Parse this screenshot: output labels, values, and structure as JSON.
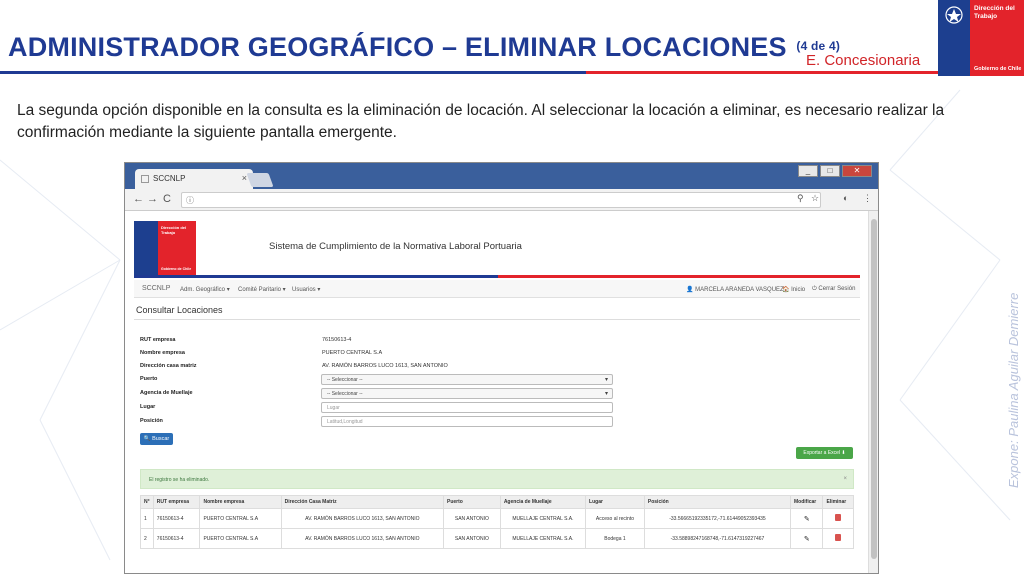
{
  "slide": {
    "title": "ADMINISTRADOR GEOGRÁFICO – ELIMINAR LOCACIONES",
    "title_sub": "(4 de 4)",
    "section": "E. Concesionaria",
    "intro": "La segunda opción disponible en la consulta es la eliminación de locación. Al seleccionar la locación a eliminar, es necesario realizar la confirmación mediante la siguiente pantalla emergente.",
    "credit": "Expone: Paulina Aguilar Demierre",
    "logo": {
      "line1": "Dirección del",
      "line2": "Trabajo",
      "footer": "Gobierno de Chile"
    },
    "colors": {
      "blue": "#1f3a93",
      "red": "#e3232b"
    }
  },
  "browser": {
    "tab_title": "SCCNLP",
    "tab_close": "×",
    "nav_back": "←",
    "nav_forward": "→",
    "nav_reload": "C",
    "url_info": "ⓘ",
    "win_min": "_",
    "win_max": "□",
    "win_close": "✕"
  },
  "app": {
    "logo": {
      "line1": "Dirección del",
      "line2": "Trabajo",
      "footer": "Gobierno de Chile"
    },
    "title": "Sistema de Cumplimiento de la Normativa Laboral Portuaria",
    "brand": "SCCNLP",
    "menu": [
      "Adm. Geográfico ▾",
      "Comité Paritario ▾",
      "Usuarios ▾"
    ],
    "user": "👤 MARCELA ARANEDA VASQUEZ",
    "home": "🏠 Inicio",
    "logout": "⏻ Cerrar Sesión",
    "panel_title": "Consultar Locaciones",
    "fields": {
      "rut_label": "RUT empresa",
      "rut_value": "76150613-4",
      "nombre_label": "Nombre empresa",
      "nombre_value": "PUERTO CENTRAL S.A",
      "direccion_label": "Dirección casa matriz",
      "direccion_value": "AV. RAMÓN BARROS LUCO 1613, SAN ANTONIO",
      "puerto_label": "Puerto",
      "puerto_value": "-- Seleccionar --",
      "agencia_label": "Agencia de Muellaje",
      "agencia_value": "-- Seleccionar --",
      "lugar_label": "Lugar",
      "lugar_placeholder": "Lugar",
      "posicion_label": "Posición",
      "posicion_placeholder": "Latitud,Longitud"
    },
    "buscar": "🔍 Buscar",
    "exportar": "Exportar a Excel ⬇",
    "alert": "El registro se ha eliminado.",
    "alert_close": "×",
    "table": {
      "headers": [
        "N°",
        "RUT empresa",
        "Nombre empresa",
        "Dirección Casa Matriz",
        "Puerto",
        "Agencia de Muellaje",
        "Lugar",
        "Posición",
        "Modificar",
        "Eliminar"
      ],
      "rows": [
        [
          "1",
          "76150613-4",
          "PUERTO CENTRAL S.A",
          "AV. RAMÓN BARROS LUCO 1613, SAN ANTONIO",
          "SAN ANTONIO",
          "MUELLAJE CENTRAL S.A.",
          "Acceso al recinto",
          "-33.56665192335172,-71.61449052393435"
        ],
        [
          "2",
          "76150613-4",
          "PUERTO CENTRAL S.A",
          "AV. RAMÓN BARROS LUCO 1613, SAN ANTONIO",
          "SAN ANTONIO",
          "MUELLAJE CENTRAL S.A.",
          "Bodega 1",
          "-33.58898247168748,-71.6147319227467"
        ]
      ]
    }
  }
}
